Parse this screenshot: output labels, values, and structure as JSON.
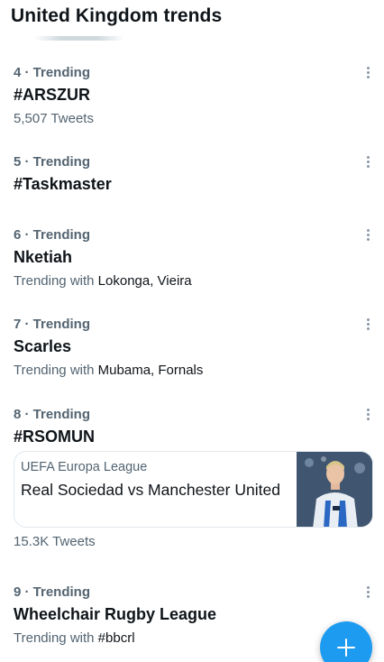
{
  "header": {
    "title": "United Kingdom trends"
  },
  "trends": [
    {
      "meta": "4 · Trending",
      "name": "#ARSZUR",
      "count": "5,507 Tweets"
    },
    {
      "meta": "5 · Trending",
      "name": "#Taskmaster"
    },
    {
      "meta": "6 · Trending",
      "name": "Nketiah",
      "with_prefix": "Trending with",
      "with_names": "Lokonga, Vieira"
    },
    {
      "meta": "7 · Trending",
      "name": "Scarles",
      "with_prefix": "Trending with",
      "with_names": "Mubama, Fornals"
    },
    {
      "meta": "8 · Trending",
      "name": "#RSOMUN",
      "card": {
        "kicker": "UEFA Europa League",
        "title": "Real Sociedad vs Manchester United",
        "image": "football-player-photo"
      },
      "count": "15.3K Tweets"
    },
    {
      "meta": "9 · Trending",
      "name": "Wheelchair Rugby League",
      "with_prefix": "Trending with",
      "with_names": "#bbcrl"
    }
  ],
  "icons": {
    "more": "more-vertical-icon",
    "compose": "plus-icon"
  },
  "colors": {
    "accent": "#1d9bf0",
    "text_primary": "#0f1419",
    "text_secondary": "#536471"
  }
}
